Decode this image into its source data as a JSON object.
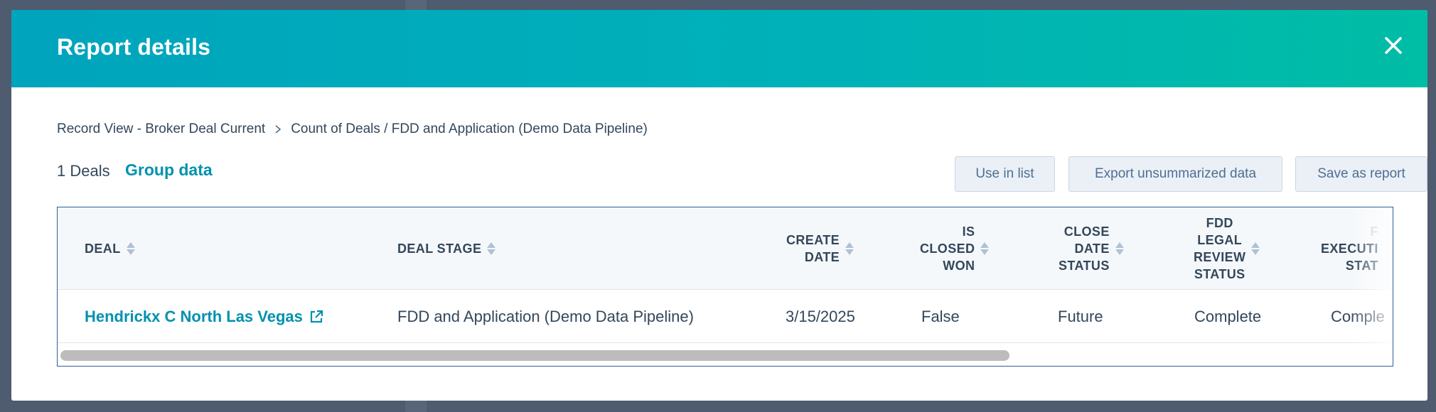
{
  "modal": {
    "title": "Report details"
  },
  "breadcrumb": {
    "items": [
      "Record View - Broker Deal Current",
      "Count of Deals / FDD and Application (Demo Data Pipeline)"
    ]
  },
  "toolbar": {
    "count_label": "1 Deals",
    "group_data_label": "Group data",
    "use_in_list_label": "Use in list",
    "export_label": "Export unsummarized data",
    "save_label": "Save as report"
  },
  "table": {
    "columns": [
      "DEAL",
      "DEAL STAGE",
      "CREATE DATE",
      "IS CLOSED WON",
      "CLOSE DATE STATUS",
      "FDD LEGAL REVIEW STATUS",
      "F EXECUTI STAT"
    ],
    "column_lines": [
      [
        "DEAL"
      ],
      [
        "DEAL STAGE"
      ],
      [
        "CREATE",
        "DATE"
      ],
      [
        "IS",
        "CLOSED",
        "WON"
      ],
      [
        "CLOSE",
        "DATE",
        "STATUS"
      ],
      [
        "FDD",
        "LEGAL",
        "REVIEW",
        "STATUS"
      ],
      [
        "F",
        "EXECUTI",
        "STAT"
      ]
    ],
    "rows": [
      {
        "deal": "Hendrickx C North Las Vegas",
        "deal_stage": "FDD and Application (Demo Data Pipeline)",
        "create_date": "3/15/2025",
        "is_closed_won": "False",
        "close_date_status": "Future",
        "fdd_legal_review_status": "Complete",
        "executive_status": "Comple"
      }
    ]
  },
  "colors": {
    "header_gradient_start": "#00a4bd",
    "header_gradient_end": "#00bda5",
    "link": "#0091ae",
    "text": "#33475b"
  },
  "icons": {
    "close": "close-icon",
    "breadcrumb_separator": "chevron-right-icon",
    "sort": "sort-icon",
    "external_link": "external-link-icon"
  }
}
